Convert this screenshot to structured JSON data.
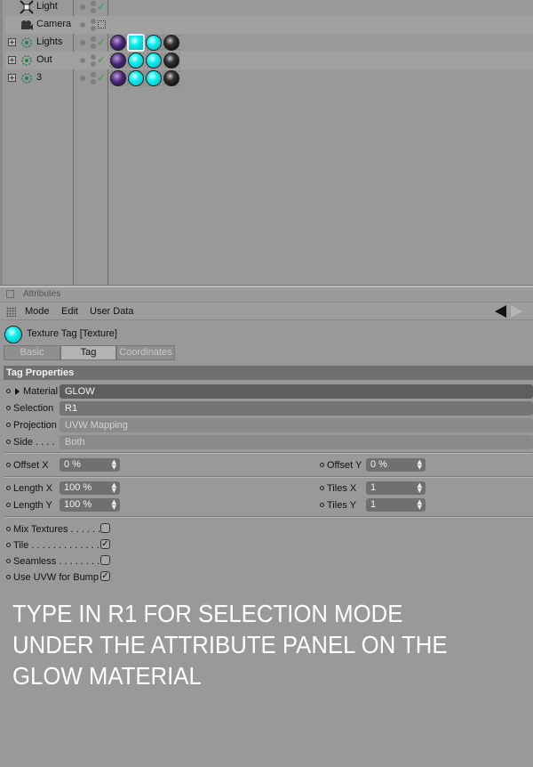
{
  "objects": [
    {
      "name": "Light",
      "icon": "light-icon",
      "expandable": false,
      "check": true,
      "tags": []
    },
    {
      "name": "Camera",
      "icon": "camera-icon",
      "expandable": false,
      "check": false,
      "tags": []
    },
    {
      "name": "Lights",
      "icon": "null-group-icon",
      "expandable": true,
      "check": true,
      "tags": [
        "purple",
        "cyan",
        "cyan",
        "black"
      ]
    },
    {
      "name": "Out",
      "icon": "null-group-icon",
      "expandable": true,
      "check": true,
      "tags": [
        "purple",
        "cyan",
        "cyan",
        "black"
      ]
    },
    {
      "name": "3",
      "icon": "null-group-icon",
      "expandable": true,
      "check": true,
      "tags": [
        "purple",
        "cyan",
        "cyan",
        "black"
      ]
    }
  ],
  "attributes": {
    "panel_title": "Attributes",
    "menu": {
      "mode": "Mode",
      "edit": "Edit",
      "user_data": "User Data"
    },
    "object_label": "Texture Tag [Texture]",
    "tabs": {
      "basic": "Basic",
      "tag": "Tag",
      "coordinates": "Coordinates"
    },
    "section_title": "Tag Properties",
    "material": {
      "label": "Material",
      "value": "GLOW"
    },
    "selection": {
      "label": "Selection",
      "value": "R1"
    },
    "projection": {
      "label": "Projection",
      "value": "UVW Mapping"
    },
    "side": {
      "label": "Side . . . .",
      "value": "Both"
    },
    "offset_x": {
      "label": "Offset X",
      "value": "0 %"
    },
    "offset_y": {
      "label": "Offset Y",
      "value": "0 %"
    },
    "length_x": {
      "label": "Length X",
      "value": "100 %"
    },
    "length_y": {
      "label": "Length Y",
      "value": "100 %"
    },
    "tiles_x": {
      "label": "Tiles X",
      "value": "1"
    },
    "tiles_y": {
      "label": "Tiles Y",
      "value": "1"
    },
    "mix_textures": {
      "label": "Mix Textures . . . . . .",
      "checked": false
    },
    "tile": {
      "label": "Tile . . . . . . . . . . . . .",
      "checked": true
    },
    "seamless": {
      "label": "Seamless . . . . . . . . .",
      "checked": false
    },
    "use_uvw_bump": {
      "label": "Use UVW for Bump",
      "checked": true
    }
  },
  "caption": "TYPE IN R1 FOR SELECTION MODE UNDER THE ATTRIBUTE PANEL ON THE GLOW MATERIAL",
  "colors": {
    "tag_cyan": "#10f0f0",
    "tag_purple": "#4c2a7a",
    "section_bg": "#6f6f6f"
  }
}
